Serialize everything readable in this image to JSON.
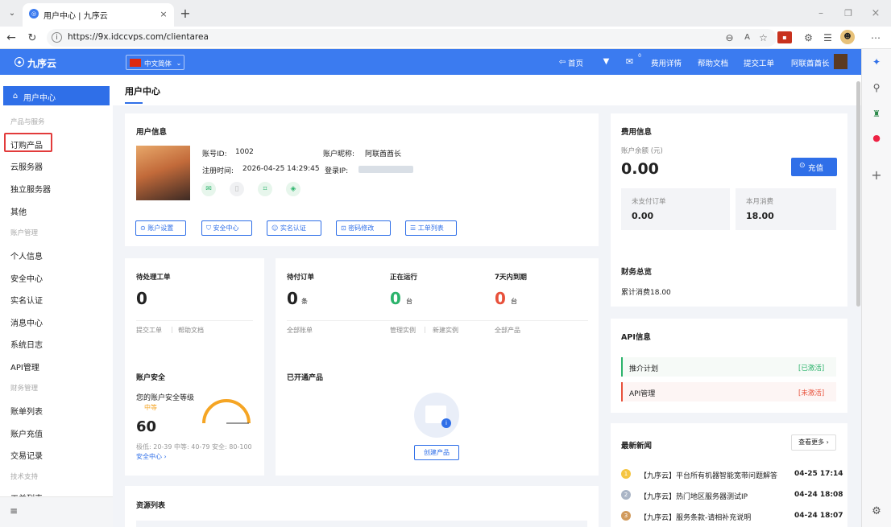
{
  "browser": {
    "tab_title": "用户中心 | 九序云",
    "url": "https://9x.idccvps.com/clientarea"
  },
  "header": {
    "logo": "九序云",
    "language": "中文简体",
    "home": "首页",
    "msg_count": "0",
    "cost_detail": "费用详情",
    "help_docs": "帮助文档",
    "submit_ticket": "提交工单",
    "username": "阿联酋酋长"
  },
  "sidebar": {
    "active": "用户中心",
    "section1": "产品与服务",
    "items1": [
      "订购产品",
      "云服务器",
      "独立服务器",
      "其他"
    ],
    "section2": "账户管理",
    "items2": [
      "个人信息",
      "安全中心",
      "实名认证",
      "消息中心",
      "系统日志",
      "API管理"
    ],
    "section3": "财务管理",
    "items3": [
      "账单列表",
      "账户充值",
      "交易记录"
    ],
    "section4": "技术支持",
    "items4_partial": "工单列表"
  },
  "page_title": "用户中心",
  "user_info": {
    "title": "用户信息",
    "account_id_label": "账号ID:",
    "account_id": "1002",
    "nickname_label": "账户昵称:",
    "nickname": "阿联酋酋长",
    "reg_time_label": "注册时间:",
    "reg_time": "2026-04-25 14:29:45",
    "login_ip_label": "登录IP:",
    "buttons": [
      "账户设置",
      "安全中心",
      "实名认证",
      "密码修改",
      "工单列表"
    ]
  },
  "fee_info": {
    "title": "费用信息",
    "balance_label": "账户余额 (元)",
    "balance": "0.00",
    "recharge": "充值",
    "unpaid_label": "未支付订单",
    "unpaid_value": "0.00",
    "month_label": "本月消费",
    "month_value": "18.00"
  },
  "stats": {
    "pending_tickets_label": "待处理工单",
    "pending_tickets": "0",
    "ticket_link1": "提交工单",
    "ticket_link2": "帮助文档",
    "unpaid_orders_label": "待付订单",
    "unpaid_orders": "0",
    "unit_tiao": "条",
    "all_bills": "全部账单",
    "running_label": "正在运行",
    "running": "0",
    "unit_tai": "台",
    "manage": "管理实例",
    "new_instance": "新建实例",
    "expiring_label": "7天内到期",
    "expiring": "0",
    "all_products": "全部产品"
  },
  "finance": {
    "title": "财务总览",
    "total": "累计消费18.00"
  },
  "api": {
    "title": "API信息",
    "row1_label": "推介计划",
    "row1_status": "[已激活]",
    "row2_label": "API管理",
    "row2_status": "[未激活]",
    "green": "#2bb36b",
    "red": "#e8513b"
  },
  "security": {
    "title": "账户安全",
    "level_label": "您的账户安全等级",
    "level": "中等",
    "score": "60",
    "score_fraction": 0.6,
    "ranges": "极低: 20-39 中等: 40-79 安全: 80-100",
    "link": "安全中心 ›"
  },
  "products": {
    "title": "已开通产品",
    "create": "创建产品"
  },
  "resources": {
    "title": "资源列表"
  },
  "news": {
    "title": "最新新闻",
    "more": "查看更多 ›",
    "items": [
      {
        "num": "1",
        "text": "【九序云】平台所有机器智能宽带问题解答",
        "date": "04-25 17:14"
      },
      {
        "num": "2",
        "text": "【九序云】热门地区服务器测试IP",
        "date": "04-24 18:08"
      },
      {
        "num": "3",
        "text": "【九序云】服务条款-请相补充说明",
        "date": "04-24 18:07"
      }
    ]
  },
  "colors": {
    "primary": "#3b7bf0",
    "orange": "#f5a524",
    "highlight_red": "#e23b3b"
  }
}
